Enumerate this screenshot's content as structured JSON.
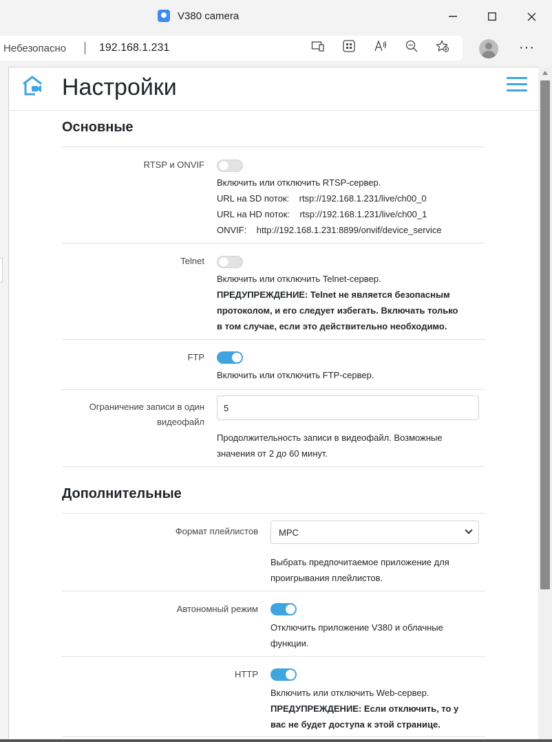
{
  "window": {
    "title": "V380 camera",
    "minimize": "—",
    "maximize": "☐",
    "close": "✕"
  },
  "addressbar": {
    "security": "Небезопасно",
    "url": "192.168.1.231",
    "icons": [
      "device-icon",
      "apps-icon",
      "read-aloud-icon",
      "zoom-icon",
      "favorites-add-icon"
    ],
    "more": "···"
  },
  "page": {
    "title": "Настройки",
    "sections": {
      "basic": {
        "title": "Основные",
        "rtsp": {
          "label": "RTSP и ONVIF",
          "enabled": false,
          "desc": "Включить или отключить RTSP-сервер.",
          "sd_label": "URL на SD поток:",
          "sd_url": "rtsp://192.168.1.231/live/ch00_0",
          "hd_label": "URL на HD поток:",
          "hd_url": "rtsp://192.168.1.231/live/ch00_1",
          "onvif_label": "ONVIF:",
          "onvif_url": "http://192.168.1.231:8899/onvif/device_service"
        },
        "telnet": {
          "label": "Telnet",
          "enabled": false,
          "desc": "Включить или отключить Telnet-сервер.",
          "warning_1": "ПРЕДУПРЕЖДЕНИЕ: Telnet не является безопасным",
          "warning_2": "протоколом, и его следует избегать. Включать только",
          "warning_3": "в том случае, если это действительно необходимо."
        },
        "ftp": {
          "label": "FTP",
          "enabled": true,
          "desc": "Включить или отключить FTP-сервер."
        },
        "record_limit": {
          "label_1": "Ограничение записи в один",
          "label_2": "видеофайл",
          "value": "5",
          "desc_1": "Продолжительность записи в видеофайл. Возможные",
          "desc_2": "значения от 2 до 60 минут."
        }
      },
      "advanced": {
        "title": "Дополнительные",
        "playlist": {
          "label": "Формат плейлистов",
          "value": "MPC",
          "desc_1": "Выбрать предпочитаемое приложение для",
          "desc_2": "проигрывания плейлистов."
        },
        "offline": {
          "label": "Автономный режим",
          "enabled": true,
          "desc_1": "Отключить приложение V380 и облачные",
          "desc_2": "функции."
        },
        "http": {
          "label": "HTTP",
          "enabled": true,
          "desc": "Включить или отключить Web-сервер.",
          "warning_1": "ПРЕДУПРЕЖДЕНИЕ: Если отключить, то у",
          "warning_2": "вас не будет доступа к этой странице."
        }
      }
    }
  },
  "colors": {
    "accent": "#3fa4e0",
    "toggle_off": "#e3e3e3",
    "divider": "#e2e2e2"
  }
}
